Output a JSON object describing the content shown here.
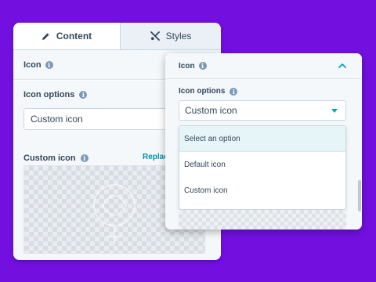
{
  "back_panel": {
    "tabs": [
      {
        "label": "Content",
        "icon": "pencil-icon",
        "active": true
      },
      {
        "label": "Styles",
        "icon": "wrench-icon",
        "active": false
      }
    ],
    "section_title": "Icon",
    "icon_options_label": "Icon options",
    "icon_options_value": "Custom icon",
    "custom_icon_label": "Custom icon",
    "replace_link": "Replace"
  },
  "front_panel": {
    "section_title": "Icon",
    "icon_options_label": "Icon options",
    "select_value": "Custom icon",
    "dropdown_options": [
      "Select an option",
      "Default icon",
      "Custom icon"
    ],
    "highlighted_option": "Select an option"
  },
  "colors": {
    "background": "#7310e0",
    "accent": "#00a4bd",
    "link": "#0091ae",
    "text": "#33475b"
  }
}
